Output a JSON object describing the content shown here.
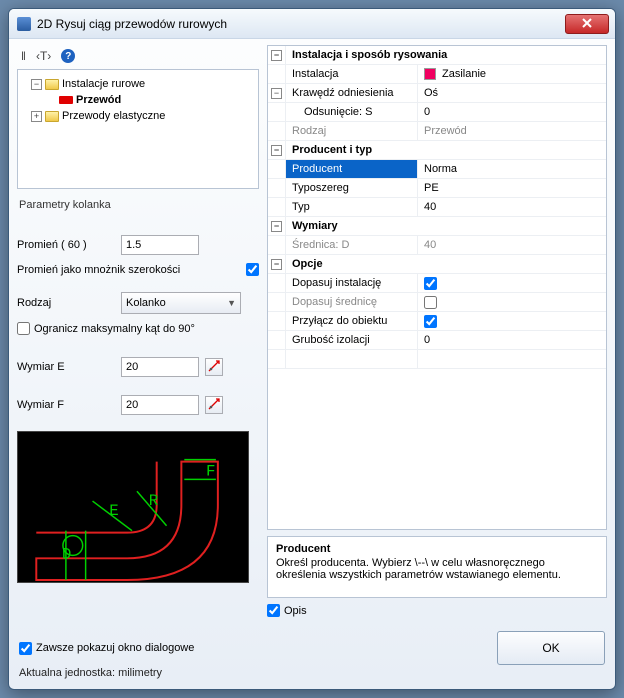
{
  "window": {
    "title": "2D Rysuj ciąg przewodów rurowych"
  },
  "toolbar": {
    "text_hint": "‹T›"
  },
  "tree": {
    "root1": "Instalacje rurowe",
    "child1": "Przewód",
    "root2": "Przewody elastyczne"
  },
  "left": {
    "section_params": "Parametry kolanka",
    "radius_label": "Promień ( 60 )",
    "radius_value": "1.5",
    "mult_label": "Promień jako mnożnik szerokości",
    "rodzaj_label": "Rodzaj",
    "rodzaj_value": "Kolanko",
    "limit90_label": "Ogranicz maksymalny kąt do 90°",
    "wymE_label": "Wymiar E",
    "wymE_value": "20",
    "wymF_label": "Wymiar F",
    "wymF_value": "20"
  },
  "grid": {
    "g1": "Instalacja i sposób rysowania",
    "r1l": "Instalacja",
    "r1v": "Zasilanie",
    "r2l": "Krawędź odniesienia",
    "r2v": "Oś",
    "r3l": "Odsunięcie: S",
    "r3v": "0",
    "r4l": "Rodzaj",
    "r4v": "Przewód",
    "g2": "Producent i typ",
    "r5l": "Producent",
    "r5v": "Norma",
    "r6l": "Typoszereg",
    "r6v": "PE",
    "r7l": "Typ",
    "r7v": "40",
    "g3": "Wymiary",
    "r8l": "Średnica: D",
    "r8v": "40",
    "g4": "Opcje",
    "r9l": "Dopasuj instalację",
    "r10l": "Dopasuj średnicę",
    "r11l": "Przyłącz do obiektu",
    "r12l": "Grubość izolacji",
    "r12v": "0"
  },
  "desc": {
    "title": "Producent",
    "body": "Określ producenta. Wybierz \\--\\ w celu własnoręcznego określenia wszystkich parametrów wstawianego elementu."
  },
  "opis_label": "Opis",
  "always_show": "Zawsze pokazuj okno dialogowe",
  "unit": "Aktualna jednostka: milimetry",
  "ok": "OK"
}
